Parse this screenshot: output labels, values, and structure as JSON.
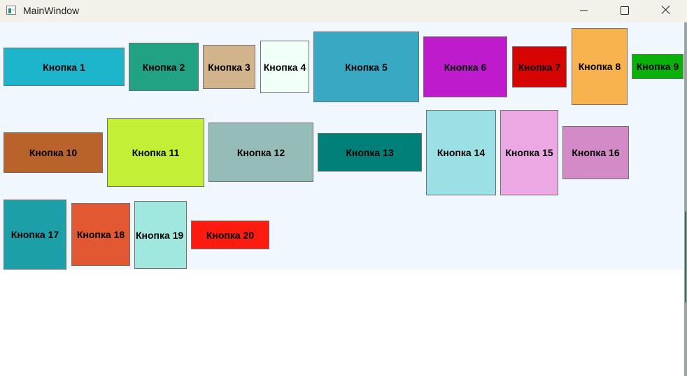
{
  "window": {
    "title": "MainWindow"
  },
  "buttons": [
    {
      "label": "Кнопка 1",
      "color": "#1cb5cb"
    },
    {
      "label": "Кнопка 2",
      "color": "#21a283"
    },
    {
      "label": "Кнопка 3",
      "color": "#d2b48c"
    },
    {
      "label": "Кнопка 4",
      "color": "#f0fff8"
    },
    {
      "label": "Кнопка 5",
      "color": "#38a8c3"
    },
    {
      "label": "Кнопка 6",
      "color": "#bd1bcc"
    },
    {
      "label": "Кнопка 7",
      "color": "#d70404"
    },
    {
      "label": "Кнопка 8",
      "color": "#f8b24e"
    },
    {
      "label": "Кнопка 9",
      "color": "#0ab10a"
    },
    {
      "label": "Кнопка 10",
      "color": "#b9622c"
    },
    {
      "label": "Кнопка 11",
      "color": "#c3ef36"
    },
    {
      "label": "Кнопка 12",
      "color": "#96bcb8"
    },
    {
      "label": "Кнопка 13",
      "color": "#01807a"
    },
    {
      "label": "Кнопка 14",
      "color": "#9be0e4"
    },
    {
      "label": "Кнопка 15",
      "color": "#eba8e3"
    },
    {
      "label": "Кнопка 16",
      "color": "#d38bc8"
    },
    {
      "label": "Кнопка 17",
      "color": "#1d9fa7"
    },
    {
      "label": "Кнопка 18",
      "color": "#e25833"
    },
    {
      "label": "Кнопка 19",
      "color": "#a0e8df"
    },
    {
      "label": "Кнопка 20",
      "color": "#fb1b0f"
    }
  ]
}
